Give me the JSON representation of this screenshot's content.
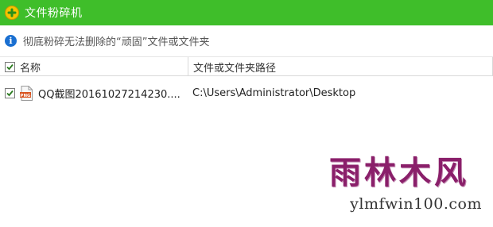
{
  "window": {
    "title": "文件粉碎机"
  },
  "info": {
    "text": "彻底粉碎无法删除的“顽固”文件或文件夹"
  },
  "table": {
    "columns": {
      "name": "名称",
      "path": "文件或文件夹路径"
    },
    "rows": [
      {
        "checked": true,
        "icon": "png-file-icon",
        "name": "QQ截图20161027214230....",
        "path": "C:\\Users\\Administrator\\Desktop"
      }
    ]
  },
  "watermark": {
    "cn": "雨林木风",
    "en": "ylmfwin100.com"
  },
  "colors": {
    "titlebar": "#3fbe2a",
    "info_icon": "#1a6fd1",
    "watermark": "#8a1f6a"
  }
}
